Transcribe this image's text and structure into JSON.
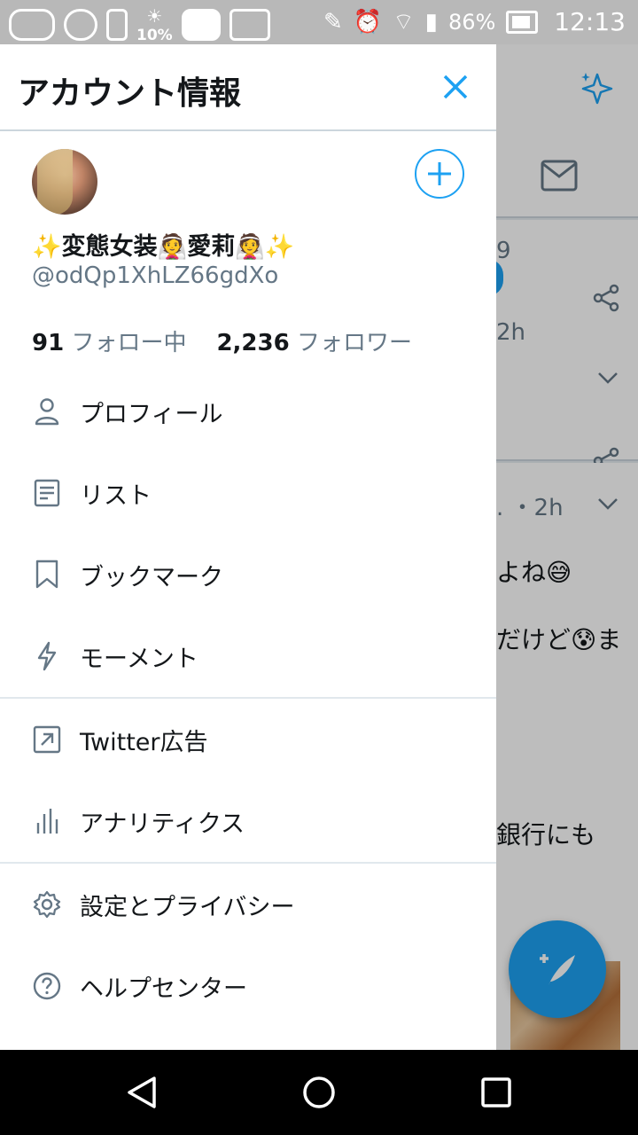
{
  "status_bar": {
    "temperature": "10%",
    "battery": "86%",
    "time": "12:13"
  },
  "drawer": {
    "title": "アカウント情報",
    "profile": {
      "display_name": "✨変態女装👰愛莉👰✨",
      "handle": "@odQp1XhLZ66gdXo",
      "following_count": "91",
      "following_label": "フォロー中",
      "followers_count": "2,236",
      "followers_label": "フォロワー"
    },
    "menu_group1": [
      {
        "label": "プロフィール",
        "icon": "person-icon"
      },
      {
        "label": "リスト",
        "icon": "list-icon"
      },
      {
        "label": "ブックマーク",
        "icon": "bookmark-icon"
      },
      {
        "label": "モーメント",
        "icon": "lightning-icon"
      }
    ],
    "menu_group2": [
      {
        "label": "Twitter広告",
        "icon": "external-arrow-icon"
      },
      {
        "label": "アナリティクス",
        "icon": "analytics-icon"
      }
    ],
    "menu_group3": [
      {
        "label": "設定とプライバシー",
        "icon": "gear-icon"
      },
      {
        "label": "ヘルプセンター",
        "icon": "help-icon"
      }
    ]
  },
  "background": {
    "tweet1_frag": "9",
    "tweet1_time": "2h",
    "tweet2_meta": ". ・2h",
    "line1": "よね😅",
    "line2": "だけど😰ま",
    "line3": "銀行にも"
  },
  "colors": {
    "accent": "#1da1f2",
    "text": "#14171a",
    "muted": "#657786"
  }
}
